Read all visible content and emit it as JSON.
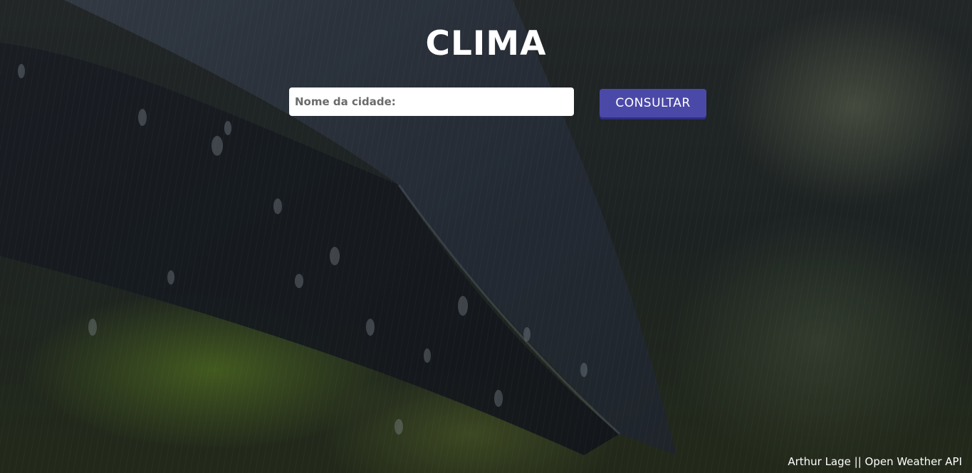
{
  "page": {
    "title": "CLIMA"
  },
  "search": {
    "placeholder": "Nome da cidade:",
    "value": "",
    "button_label": "CONSULTAR"
  },
  "footer": {
    "credit": "Arthur Lage || Open Weather API"
  },
  "background": {
    "description_icon": "rain-umbrella-photo"
  },
  "colors": {
    "button": "#4b49a8",
    "title": "#ffffff"
  }
}
